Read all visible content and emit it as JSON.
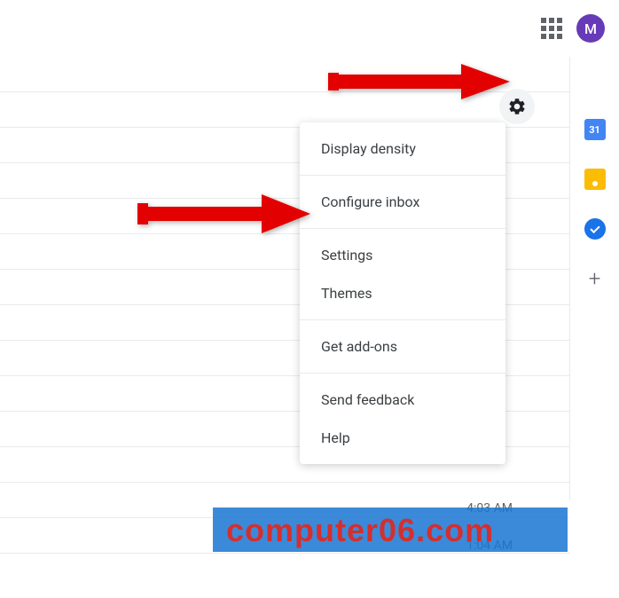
{
  "header": {
    "avatar_letter": "M"
  },
  "menu": {
    "display_density": "Display density",
    "configure_inbox": "Configure inbox",
    "settings": "Settings",
    "themes": "Themes",
    "get_addons": "Get add-ons",
    "send_feedback": "Send feedback",
    "help": "Help"
  },
  "side_panel": {
    "calendar_day": "31"
  },
  "timestamps": {
    "t1": "4:03 AM",
    "t2": "1:04 AM"
  },
  "watermark": "computer06.com"
}
